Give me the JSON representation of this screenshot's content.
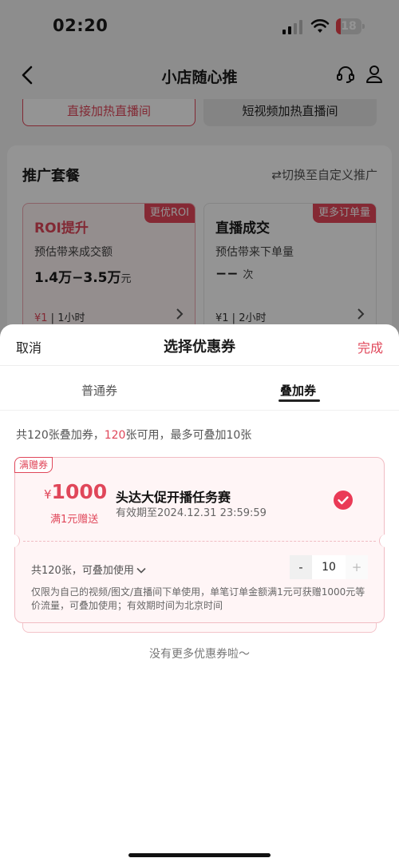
{
  "status_bar": {
    "time": "02:20",
    "battery": "18",
    "battery_level": 0.18
  },
  "nav": {
    "title": "小店随心推"
  },
  "background": {
    "mode_tabs": [
      "直接加热直播间",
      "短视频加热直播间"
    ],
    "package_title": "推广套餐",
    "switch_link": "⇄切换至自定义推广",
    "options": [
      {
        "tag": "更优ROI",
        "name": "ROI提升",
        "desc": "预估带来成交额",
        "value": "1.4万−3.5万",
        "unit": "元",
        "price": "¥1",
        "duration": "1小时"
      },
      {
        "tag": "更多订单量",
        "name": "直播成交",
        "desc": "预估带来下单量",
        "value": "−−",
        "unit": "次",
        "price": "¥1",
        "duration": "2小时"
      }
    ]
  },
  "sheet": {
    "cancel": "取消",
    "title": "选择优惠券",
    "done": "完成",
    "tabs": [
      "普通券",
      "叠加券"
    ],
    "summary_pre": "共120张叠加券，",
    "summary_count": "120",
    "summary_post": "张可用，最多可叠加10张",
    "coupon": {
      "badge": "满赠券",
      "currency": "¥",
      "amount": "1000",
      "condition": "满1元赠送",
      "name": "头达大促开播任务赛",
      "validity": "有效期至2024.12.31 23:59:59",
      "count_text": "共120张，可叠加使用",
      "minus": "-",
      "qty": "10",
      "plus": "+",
      "desc": "仅限为自己的视频/图文/直播间下单使用，单笔订单金额满1元可获赠1000元等价流量，可叠加使用；有效期时间为北京时间"
    },
    "no_more": "没有更多优惠券啦～"
  }
}
